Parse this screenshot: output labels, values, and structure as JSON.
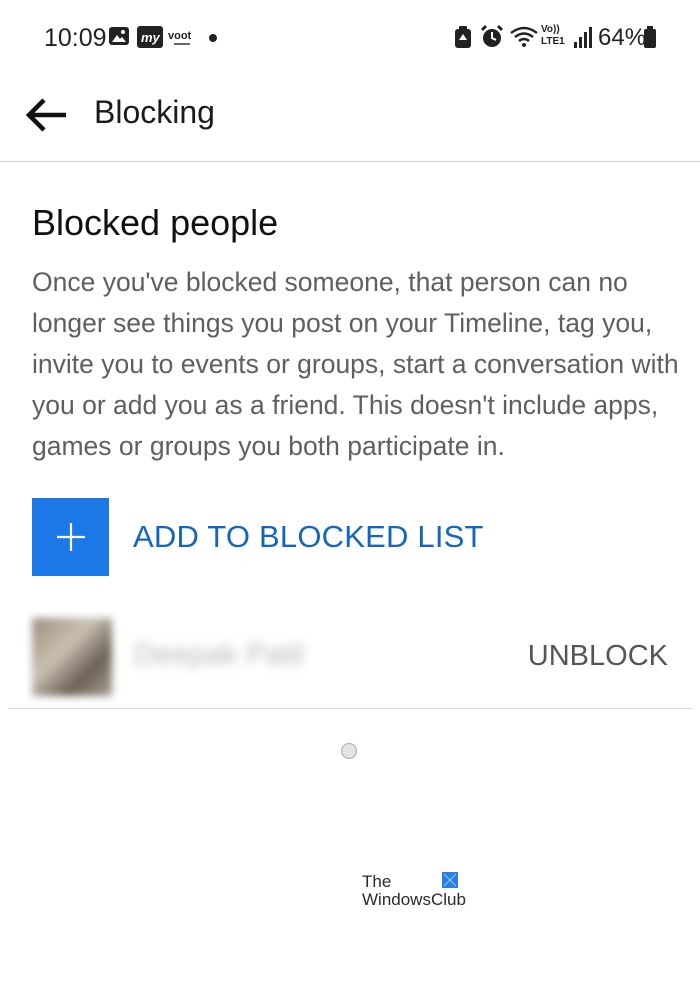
{
  "status_bar": {
    "time": "10:09",
    "left_icons": [
      "gallery-icon",
      "myjio-icon",
      "voot-icon",
      "dot-icon"
    ],
    "my_label": "my",
    "voot_label": "voot",
    "signal_label": "Vo)) LTE1",
    "battery": "64%"
  },
  "app_bar": {
    "title": "Blocking"
  },
  "content": {
    "section_title": "Blocked people",
    "description": "Once you've blocked someone, that person can no longer see things you post on your Timeline, tag you, invite you to events or groups, start a conversation with you or add you as a friend. This doesn't include apps, games or groups you both participate in.",
    "add_button_label": "ADD TO BLOCKED LIST",
    "blocked_people": [
      {
        "name": "Deepak Patil",
        "action": "UNBLOCK"
      }
    ]
  },
  "watermark": {
    "line1": "The",
    "line2": "WindowsClub"
  },
  "colors": {
    "accent": "#1c78e6",
    "link": "#1565c0"
  }
}
